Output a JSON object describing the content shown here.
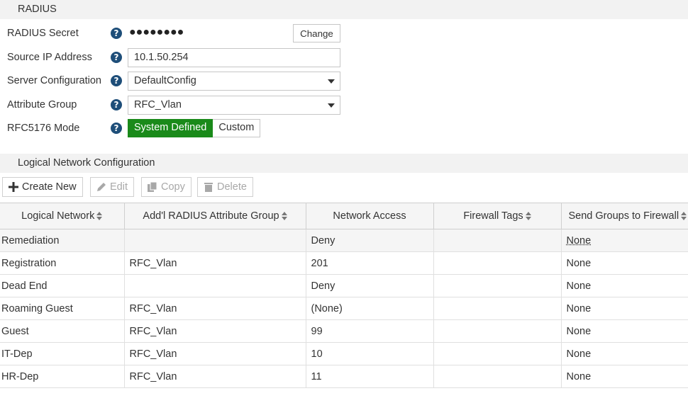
{
  "radius": {
    "section_title": "RADIUS",
    "secret_label": "RADIUS Secret",
    "secret_value": "●●●●●●●●",
    "change_button": "Change",
    "source_ip_label": "Source IP Address",
    "source_ip_value": "10.1.50.254",
    "server_config_label": "Server Configuration",
    "server_config_value": "DefaultConfig",
    "attribute_group_label": "Attribute Group",
    "attribute_group_value": "RFC_Vlan",
    "rfc_mode_label": "RFC5176 Mode",
    "rfc_mode_options": [
      "System Defined",
      "Custom"
    ],
    "rfc_mode_selected": "System Defined",
    "help_glyph": "?"
  },
  "logical": {
    "section_title": "Logical Network Configuration",
    "toolbar": {
      "create_new": "Create New",
      "edit": "Edit",
      "copy": "Copy",
      "delete": "Delete"
    },
    "columns": [
      "Logical Network",
      "Add'l RADIUS Attribute Group",
      "Network Access",
      "Firewall Tags",
      "Send Groups to Firewall"
    ],
    "rows": [
      [
        "Remediation",
        "",
        "Deny",
        "",
        "None"
      ],
      [
        "Registration",
        "RFC_Vlan",
        "201",
        "",
        "None"
      ],
      [
        "Dead End",
        "",
        "Deny",
        "",
        "None"
      ],
      [
        "Roaming Guest",
        "RFC_Vlan",
        "(None)",
        "",
        "None"
      ],
      [
        "Guest",
        "RFC_Vlan",
        "99",
        "",
        "None"
      ],
      [
        "IT-Dep",
        "RFC_Vlan",
        "10",
        "",
        "None"
      ],
      [
        "HR-Dep",
        "RFC_Vlan",
        "11",
        "",
        "None"
      ]
    ]
  },
  "colors": {
    "active_toggle": "#1a8a1a",
    "help_icon": "#1e4e79",
    "section_bg": "#f2f2f2"
  }
}
